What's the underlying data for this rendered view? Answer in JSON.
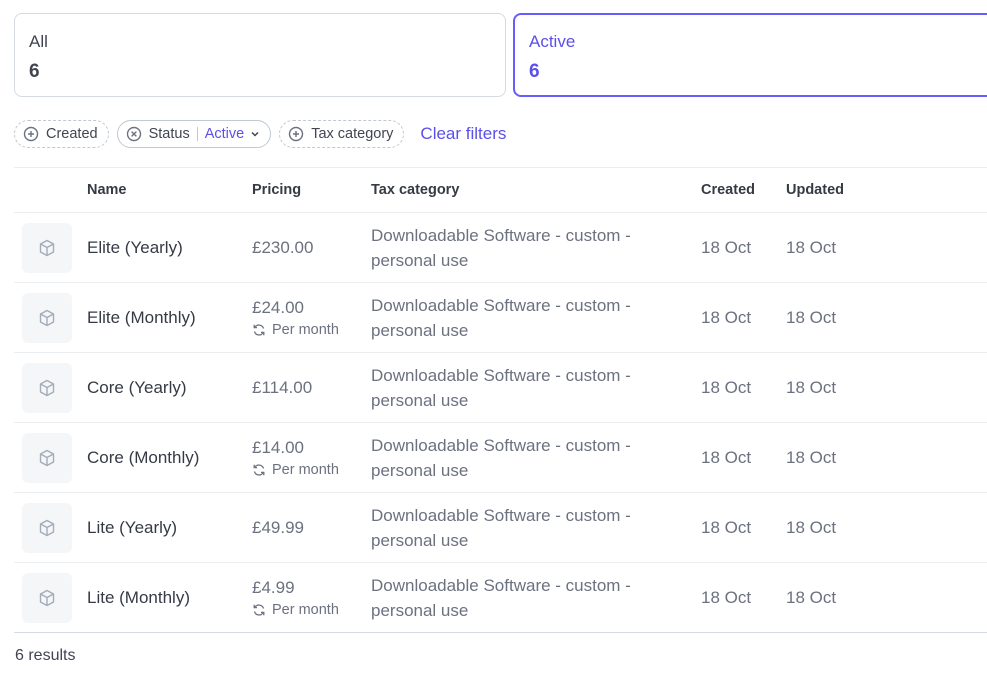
{
  "summary_cards": [
    {
      "label": "All",
      "count": "6"
    },
    {
      "label": "Active",
      "count": "6"
    }
  ],
  "filters": {
    "created_label": "Created",
    "status_label": "Status",
    "status_value": "Active",
    "tax_label": "Tax category",
    "clear_label": "Clear filters"
  },
  "table": {
    "headers": {
      "name": "Name",
      "pricing": "Pricing",
      "tax": "Tax category",
      "created": "Created",
      "updated": "Updated"
    },
    "rows": [
      {
        "name": "Elite (Yearly)",
        "price": "£230.00",
        "interval": "",
        "tax_line1": "Downloadable Software - custom -",
        "tax_line2": "personal use",
        "created": "18 Oct",
        "updated": "18 Oct"
      },
      {
        "name": "Elite (Monthly)",
        "price": "£24.00",
        "interval": "Per month",
        "tax_line1": "Downloadable Software - custom -",
        "tax_line2": "personal use",
        "created": "18 Oct",
        "updated": "18 Oct"
      },
      {
        "name": "Core (Yearly)",
        "price": "£114.00",
        "interval": "",
        "tax_line1": "Downloadable Software - custom -",
        "tax_line2": "personal use",
        "created": "18 Oct",
        "updated": "18 Oct"
      },
      {
        "name": "Core (Monthly)",
        "price": "£14.00",
        "interval": "Per month",
        "tax_line1": "Downloadable Software - custom -",
        "tax_line2": "personal use",
        "created": "18 Oct",
        "updated": "18 Oct"
      },
      {
        "name": "Lite (Yearly)",
        "price": "£49.99",
        "interval": "",
        "tax_line1": "Downloadable Software - custom -",
        "tax_line2": "personal use",
        "created": "18 Oct",
        "updated": "18 Oct"
      },
      {
        "name": "Lite (Monthly)",
        "price": "£4.99",
        "interval": "Per month",
        "tax_line1": "Downloadable Software - custom -",
        "tax_line2": "personal use",
        "created": "18 Oct",
        "updated": "18 Oct"
      }
    ]
  },
  "footer": {
    "results_text": "6 results"
  },
  "icons": {
    "product": "package-icon",
    "recurring": "refresh-icon",
    "add": "plus-circle-icon",
    "remove": "x-circle-icon",
    "chevron": "chevron-down-icon"
  },
  "colors": {
    "accent": "#675dff",
    "accent_text": "#5b4fe9",
    "border": "#d5dbe1",
    "muted_text": "#6c7180"
  }
}
